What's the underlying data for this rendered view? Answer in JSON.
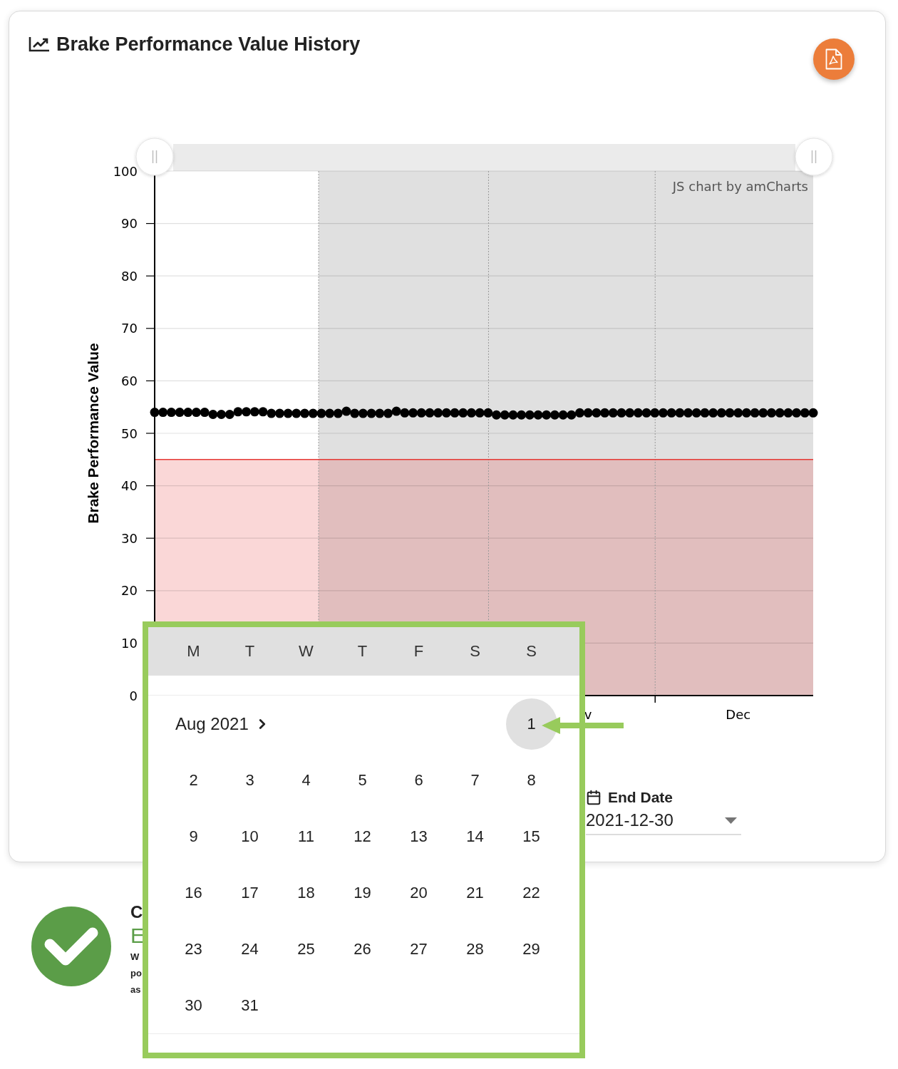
{
  "card": {
    "title": "Brake Performance Value History"
  },
  "chart": {
    "credit": "JS chart by amCharts",
    "chart_data": {
      "type": "scatter",
      "ylabel": "Brake Performance Value",
      "ylim": [
        0,
        100
      ],
      "yticks": [
        0,
        10,
        20,
        30,
        40,
        50,
        60,
        70,
        80,
        90,
        100
      ],
      "grid": true,
      "categories": [
        null,
        null,
        null,
        null,
        null,
        null,
        null,
        null,
        null,
        null,
        null,
        null,
        null,
        null,
        null,
        null,
        null,
        null,
        null,
        null,
        null,
        null,
        null,
        null,
        null,
        null,
        null,
        null,
        null,
        null,
        null,
        null,
        null,
        null,
        null,
        null,
        null,
        null,
        null,
        null,
        null,
        null,
        null,
        null,
        null,
        null,
        null,
        null,
        null,
        null,
        null,
        null,
        "v",
        null,
        null,
        null,
        null,
        null,
        null,
        null,
        null,
        null,
        null,
        null,
        null,
        null,
        null,
        null,
        null,
        null,
        "Dec",
        null,
        null,
        null,
        null,
        null,
        null,
        null,
        null,
        null
      ],
      "values": [
        54.0,
        54.0,
        54.0,
        54.0,
        54.0,
        54.0,
        54.0,
        53.6,
        53.6,
        53.6,
        54.1,
        54.1,
        54.1,
        54.1,
        53.8,
        53.8,
        53.8,
        53.8,
        53.8,
        53.8,
        53.8,
        53.8,
        53.8,
        54.2,
        53.8,
        53.8,
        53.8,
        53.8,
        53.8,
        54.2,
        53.9,
        53.9,
        53.9,
        53.9,
        53.9,
        53.9,
        53.9,
        53.9,
        53.9,
        53.9,
        53.9,
        53.5,
        53.5,
        53.5,
        53.5,
        53.5,
        53.5,
        53.5,
        53.5,
        53.5,
        53.5,
        53.9,
        53.9,
        53.9,
        53.9,
        53.9,
        53.9,
        53.9,
        53.9,
        53.9,
        53.9,
        53.9,
        53.9,
        53.9,
        53.9,
        53.9,
        53.9,
        53.9,
        53.9,
        53.9,
        53.9,
        53.9,
        53.9,
        53.9,
        53.9,
        53.9,
        53.9,
        53.9,
        53.9,
        53.9
      ],
      "bands": [
        {
          "axis": "y",
          "from": 0,
          "to": 45,
          "color": "#e53935"
        }
      ],
      "ref_lines": [
        {
          "axis": "y",
          "value": 45,
          "color": "#e53935"
        }
      ]
    }
  },
  "end_date": {
    "label": "End Date",
    "value": "2021-12-30"
  },
  "summary": {
    "heading": "C",
    "status": "E",
    "description": "W po as"
  },
  "calendar": {
    "weekdays": [
      "M",
      "T",
      "W",
      "T",
      "F",
      "S",
      "S"
    ],
    "month_label": "Aug 2021",
    "weeks": [
      [
        {
          "label": "1",
          "selected": true
        }
      ],
      [
        {
          "label": "2",
          "selected": false
        },
        {
          "label": "3",
          "selected": false
        },
        {
          "label": "4",
          "selected": false
        },
        {
          "label": "5",
          "selected": false
        },
        {
          "label": "6",
          "selected": false
        },
        {
          "label": "7",
          "selected": false
        },
        {
          "label": "8",
          "selected": false
        }
      ],
      [
        {
          "label": "9",
          "selected": false
        },
        {
          "label": "10",
          "selected": false
        },
        {
          "label": "11",
          "selected": false
        },
        {
          "label": "12",
          "selected": false
        },
        {
          "label": "13",
          "selected": false
        },
        {
          "label": "14",
          "selected": false
        },
        {
          "label": "15",
          "selected": false
        }
      ],
      [
        {
          "label": "16",
          "selected": false
        },
        {
          "label": "17",
          "selected": false
        },
        {
          "label": "18",
          "selected": false
        },
        {
          "label": "19",
          "selected": false
        },
        {
          "label": "20",
          "selected": false
        },
        {
          "label": "21",
          "selected": false
        },
        {
          "label": "22",
          "selected": false
        }
      ],
      [
        {
          "label": "23",
          "selected": false
        },
        {
          "label": "24",
          "selected": false
        },
        {
          "label": "25",
          "selected": false
        },
        {
          "label": "26",
          "selected": false
        },
        {
          "label": "27",
          "selected": false
        },
        {
          "label": "28",
          "selected": false
        },
        {
          "label": "29",
          "selected": false
        }
      ],
      [
        {
          "label": "30",
          "selected": false
        },
        {
          "label": "31",
          "selected": false
        }
      ]
    ]
  }
}
